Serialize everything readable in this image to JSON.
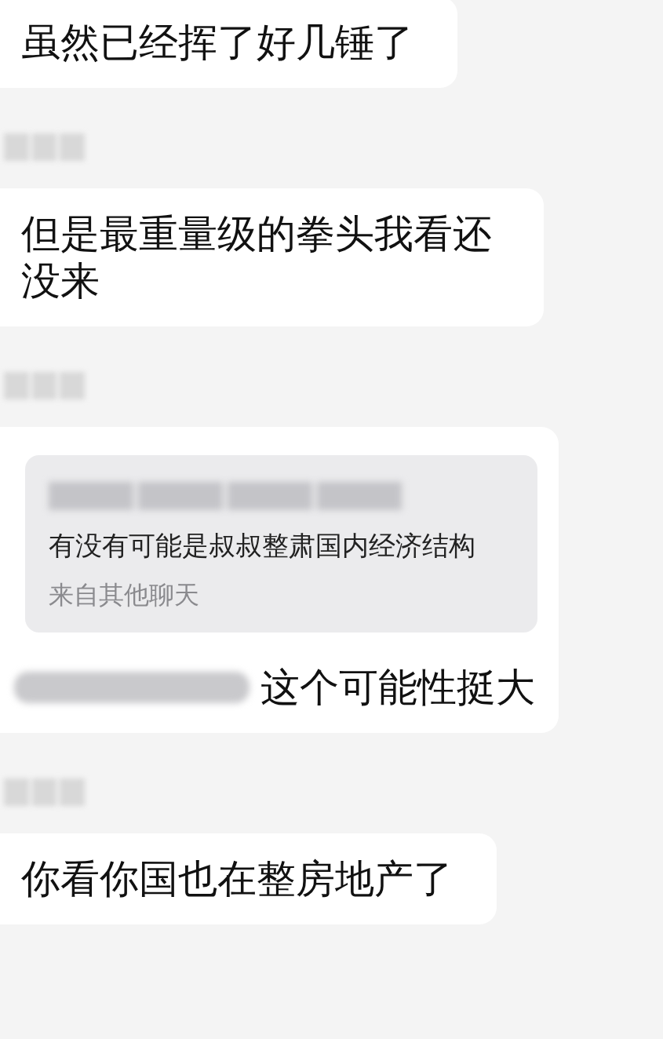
{
  "messages": [
    {
      "kind": "text",
      "text": "虽然已经挥了好几锤了"
    },
    {
      "kind": "text",
      "text": "但是最重量级的拳头我看还没来"
    },
    {
      "kind": "quote",
      "quote": {
        "text": "有没有可能是叔叔整肃国内经济结构",
        "source": "来自其他聊天"
      },
      "text": "这个可能性挺大"
    },
    {
      "kind": "text",
      "text": "你看你国也在整房地产了"
    }
  ]
}
